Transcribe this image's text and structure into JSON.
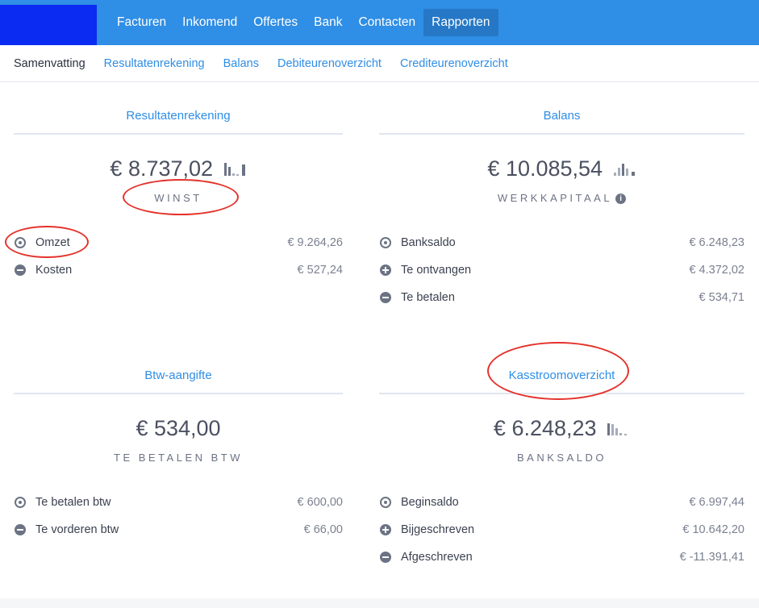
{
  "nav": {
    "items": [
      {
        "label": "Facturen",
        "active": false
      },
      {
        "label": "Inkomend",
        "active": false
      },
      {
        "label": "Offertes",
        "active": false
      },
      {
        "label": "Bank",
        "active": false
      },
      {
        "label": "Contacten",
        "active": false
      },
      {
        "label": "Rapporten",
        "active": true
      }
    ]
  },
  "subnav": {
    "items": [
      {
        "label": "Samenvatting"
      },
      {
        "label": "Resultatenrekening"
      },
      {
        "label": "Balans"
      },
      {
        "label": "Debiteurenoverzicht"
      },
      {
        "label": "Crediteurenoverzicht"
      }
    ]
  },
  "panels": {
    "resultaten": {
      "title": "Resultatenrekening",
      "value": "€ 8.737,02",
      "label": "WINST",
      "rows": [
        {
          "label": "Omzet",
          "amount": "€ 9.264,26",
          "icon": "target-icon"
        },
        {
          "label": "Kosten",
          "amount": "€ 527,24",
          "icon": "minus-icon"
        }
      ]
    },
    "balans": {
      "title": "Balans",
      "value": "€ 10.085,54",
      "label": "WERKKAPITAAL",
      "rows": [
        {
          "label": "Banksaldo",
          "amount": "€ 6.248,23",
          "icon": "target-icon"
        },
        {
          "label": "Te ontvangen",
          "amount": "€ 4.372,02",
          "icon": "plus-icon"
        },
        {
          "label": "Te betalen",
          "amount": "€ 534,71",
          "icon": "minus-icon"
        }
      ]
    },
    "btw": {
      "title": "Btw-aangifte",
      "value": "€ 534,00",
      "label": "TE BETALEN BTW",
      "rows": [
        {
          "label": "Te betalen btw",
          "amount": "€ 600,00",
          "icon": "target-icon"
        },
        {
          "label": "Te vorderen btw",
          "amount": "€ 66,00",
          "icon": "minus-icon"
        }
      ]
    },
    "kasstroom": {
      "title": "Kasstroomoverzicht",
      "value": "€ 6.248,23",
      "label": "BANKSALDO",
      "rows": [
        {
          "label": "Beginsaldo",
          "amount": "€ 6.997,44",
          "icon": "target-icon"
        },
        {
          "label": "Bijgeschreven",
          "amount": "€ 10.642,20",
          "icon": "plus-icon"
        },
        {
          "label": "Afgeschreven",
          "amount": "€ -11.391,41",
          "icon": "minus-icon"
        }
      ]
    }
  },
  "colors": {
    "primary": "#2f8ee5",
    "nav_active": "#2678c6",
    "logo": "#0b2bf2",
    "annotation": "#e4322b"
  }
}
